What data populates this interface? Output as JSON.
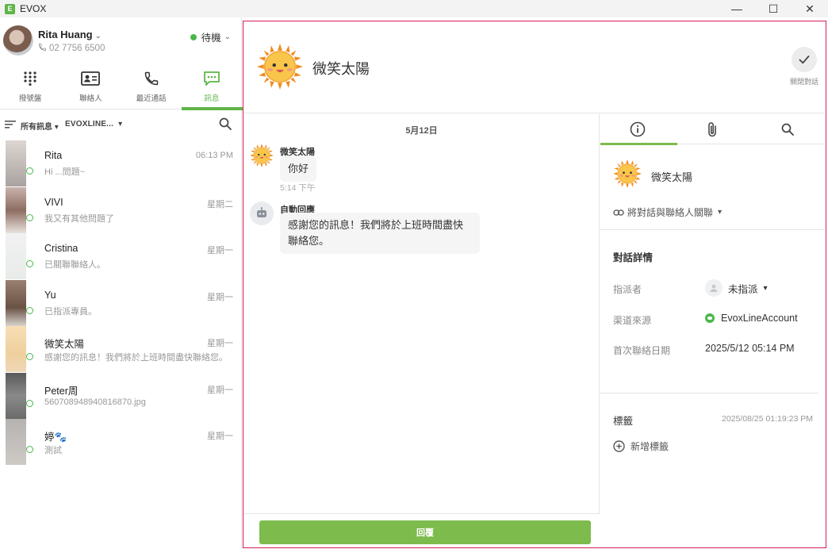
{
  "window": {
    "logo_letter": "E",
    "title": "EVOX",
    "controls": {
      "minimize": "—",
      "maximize": "☐",
      "close": "✕"
    }
  },
  "colors": {
    "brand_green": "#5fb548",
    "reply_green": "#7dbb4c",
    "focus_border": "#d41f52",
    "online": "#4bb74b"
  },
  "user": {
    "name": "Rita Huang",
    "phone": "02 7756 6500",
    "status": "待機"
  },
  "nav_tabs": [
    {
      "label": "撥號盤",
      "icon": "dialpad-icon"
    },
    {
      "label": "聯絡人",
      "icon": "contact-card-icon"
    },
    {
      "label": "最近通話",
      "icon": "phone-icon"
    },
    {
      "label": "訊息",
      "icon": "chat-bubble-icon",
      "active": true
    }
  ],
  "filter": {
    "all_messages": "所有訊息",
    "account": "EVOXLINE..."
  },
  "conversations": [
    {
      "name": "Rita",
      "time": "06:13 PM",
      "preview": "Hi ...問題~"
    },
    {
      "name": "VIVI",
      "time": "星期二",
      "preview": "我又有其他問題了"
    },
    {
      "name": "Cristina",
      "time": "星期一",
      "preview": "已關聯聯絡人。"
    },
    {
      "name": "Yu",
      "time": "星期一",
      "preview": "已指派專員。"
    },
    {
      "name": "微笑太陽",
      "time": "星期一",
      "preview": "感謝您的訊息！我們將於上班時間盡快聯絡您。"
    },
    {
      "name": "Peter周",
      "time": "星期一",
      "preview": "560708948940816870.jpg"
    },
    {
      "name": "婷🐾",
      "time": "星期一",
      "preview": "測試"
    }
  ],
  "chat": {
    "contact_name": "微笑太陽",
    "close_label": "關閉對話",
    "date_separator": "5月12日",
    "messages": [
      {
        "sender": "微笑太陽",
        "text": "你好",
        "time": "5:14 下午"
      },
      {
        "sender": "自動回應",
        "text_line1": "感謝您的訊息！我們將於上班時間盡快",
        "text_line2": "聯絡您。"
      }
    ],
    "reply_label": "回覆"
  },
  "info_panel": {
    "tabs": [
      "info-icon",
      "paperclip-icon",
      "search-icon"
    ],
    "contact_name": "微笑太陽",
    "link_contact": "將對話與聯絡人關聯",
    "details_title": "對話詳情",
    "assignee_label": "指派者",
    "assignee_value": "未指派",
    "channel_label": "渠道來源",
    "channel_value": "EvoxLineAccount",
    "first_contact_label": "首次聯絡日期",
    "first_contact_value": "2025/5/12 05:14 PM",
    "tags_title": "標籤",
    "tags_time": "2025/08/25 01:19:23 PM",
    "add_tag": "新增標籤"
  }
}
